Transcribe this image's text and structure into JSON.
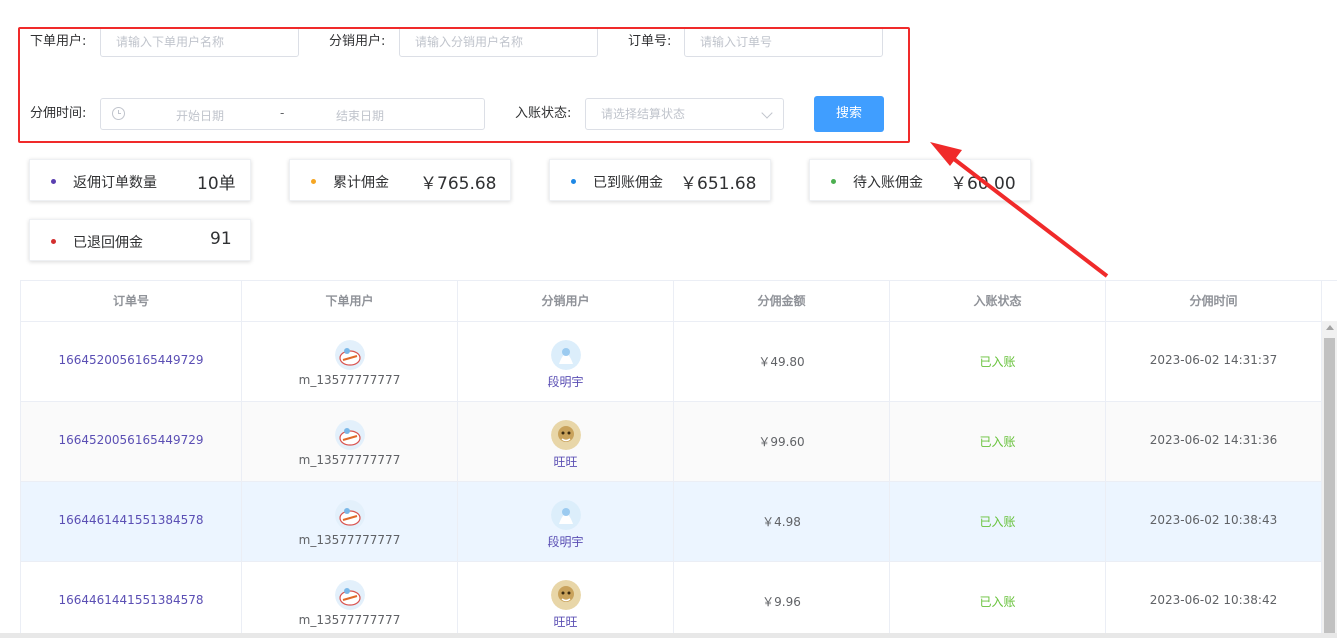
{
  "filters": {
    "buyer": {
      "label": "下单用户:",
      "placeholder": "请输入下单用户名称"
    },
    "distributor": {
      "label": "分销用户:",
      "placeholder": "请输入分销用户名称"
    },
    "order_no": {
      "label": "订单号:",
      "placeholder": "请输入订单号"
    },
    "time": {
      "label": "分佣时间:",
      "start_placeholder": "开始日期",
      "separator": "-",
      "end_placeholder": "结束日期"
    },
    "status": {
      "label": "入账状态:",
      "placeholder": "请选择结算状态"
    },
    "search_label": "搜索"
  },
  "stats": [
    {
      "label": "返佣订单数量",
      "value": "10单",
      "color": "#5a3fb0"
    },
    {
      "label": "累计佣金",
      "value": "￥765.68",
      "color": "#f5a623"
    },
    {
      "label": "已到账佣金",
      "value": "￥651.68",
      "color": "#1e88e5"
    },
    {
      "label": "待入账佣金",
      "value": "￥60.00",
      "color": "#4caf50"
    },
    {
      "label": "已退回佣金",
      "value": "91",
      "color": "#d32f2f"
    }
  ],
  "table": {
    "columns": [
      "订单号",
      "下单用户",
      "分销用户",
      "分佣金额",
      "入账状态",
      "分佣时间"
    ],
    "rows": [
      {
        "order_no": "1664520056165449729",
        "buyer": "m_13577777777",
        "distributor": "段明宇",
        "amount": "￥49.80",
        "status": "已入账",
        "time": "2023-06-02 14:31:37"
      },
      {
        "order_no": "1664520056165449729",
        "buyer": "m_13577777777",
        "distributor": "旺旺",
        "amount": "￥99.60",
        "status": "已入账",
        "time": "2023-06-02 14:31:36"
      },
      {
        "order_no": "1664461441551384578",
        "buyer": "m_13577777777",
        "distributor": "段明宇",
        "amount": "￥4.98",
        "status": "已入账",
        "time": "2023-06-02 10:38:43"
      },
      {
        "order_no": "1664461441551384578",
        "buyer": "m_13577777777",
        "distributor": "旺旺",
        "amount": "￥9.96",
        "status": "已入账",
        "time": "2023-06-02 10:38:42"
      }
    ]
  },
  "colors": {
    "highlight": "#f02a2a",
    "primary": "#409eff",
    "success": "#67c23a",
    "link": "#5b4fb4"
  }
}
